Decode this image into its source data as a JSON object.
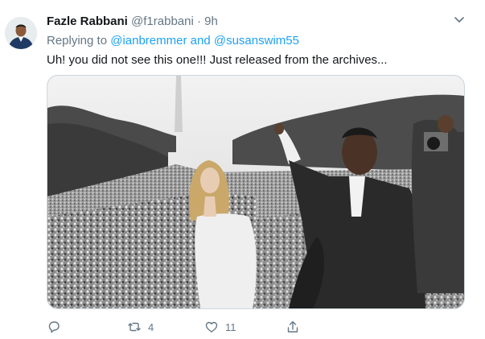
{
  "tweet": {
    "display_name": "Fazle Rabbani",
    "handle": "@f1rabbani",
    "separator": "·",
    "time": "9h",
    "replying_prefix": "Replying to ",
    "mention_1": "@ianbremmer",
    "conjunction": " and ",
    "mention_2": "@susanswim55",
    "text": "Uh! you did not see this one!!! Just released from the archives..."
  },
  "actions": {
    "reply_icon": "comment-bubble-icon",
    "retweet_icon": "retweet-icon",
    "retweet_count": "4",
    "like_icon": "heart-icon",
    "like_count": "11",
    "share_icon": "share-upload-icon"
  },
  "colors": {
    "accent": "#1da1f2",
    "muted": "#657786",
    "text": "#14171a",
    "border": "#ccd6dd"
  }
}
